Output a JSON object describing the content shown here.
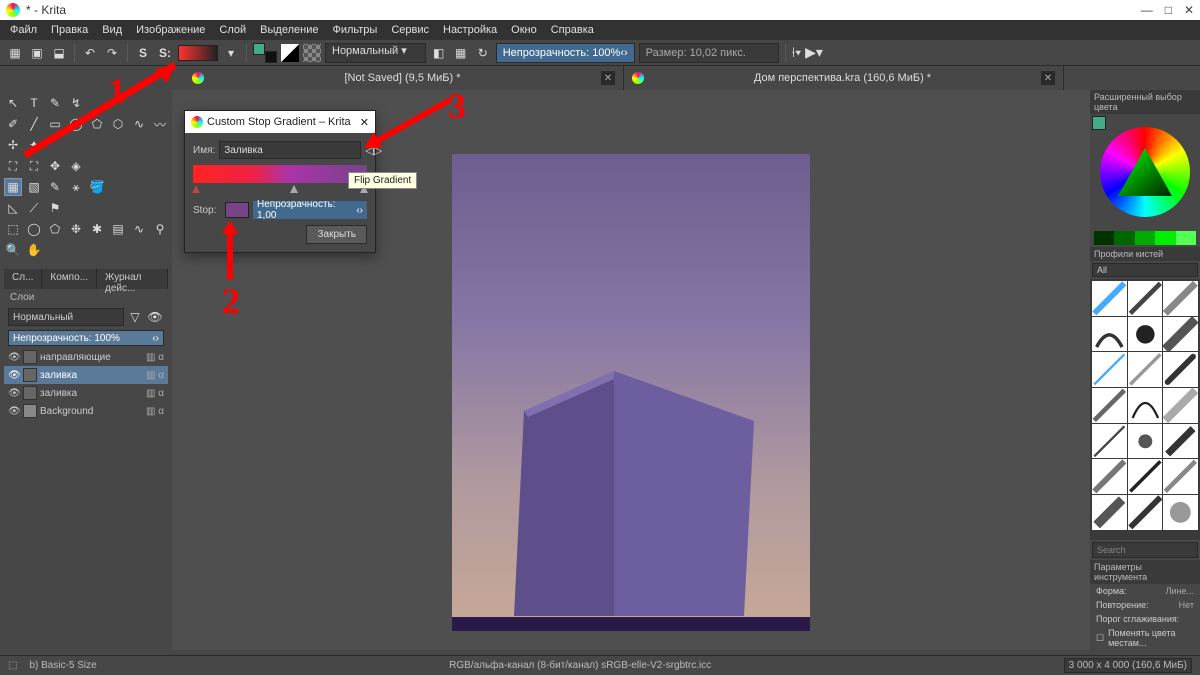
{
  "app_title": "* - Krita",
  "window_controls": {
    "min": "—",
    "max": "□",
    "close": "✕"
  },
  "menu": [
    "Файл",
    "Правка",
    "Вид",
    "Изображение",
    "Слой",
    "Выделение",
    "Фильтры",
    "Сервис",
    "Настройка",
    "Окно",
    "Справка"
  ],
  "toolbar": {
    "blend_mode": "Нормальный",
    "opacity_label": "Непрозрачность: 100%",
    "size_label": "Размер: 10,02 пикс."
  },
  "tabs": [
    {
      "title": "[Not Saved]  (9,5 МиБ) *"
    },
    {
      "title": "Дом перспектива.kra  (160,6 МиБ) *"
    }
  ],
  "left_panel": {
    "tabs": [
      "Сл...",
      "Компо...",
      "Журнал дейс..."
    ],
    "section": "Слои",
    "blend": "Нормальный",
    "opacity": "Непрозрачность:  100%",
    "layers": [
      {
        "name": "направляющие",
        "sel": false
      },
      {
        "name": "заливка",
        "sel": true
      },
      {
        "name": "заливка",
        "sel": false
      },
      {
        "name": "Background",
        "sel": false
      }
    ]
  },
  "dialog": {
    "title": "Custom Stop Gradient – Krita",
    "name_label": "Имя:",
    "name_value": "Заливка",
    "tooltip": "Flip Gradient",
    "stop_label": "Stop:",
    "stop_opacity": "Непрозрачность: 1,00",
    "close_btn": "Закрыть"
  },
  "right": {
    "color_title": "Расширенный выбор цвета",
    "brush_title": "Профили кистей",
    "brush_filter": "All",
    "search_ph": "Search",
    "toolopt_title": "Параметры инструмента",
    "shape_label": "Форма:",
    "shape_value": "Лине...",
    "repeat_label": "Повторение:",
    "repeat_value": "Нет",
    "thresh_label": "Порог сглаживания:",
    "swap_label": "Поменять цвета местам..."
  },
  "status": {
    "preset": "b)  Basic-5 Size",
    "color_info": "RGB/альфа-канал (8-бит/канал)  sRGB-elle-V2-srgbtrc.icc",
    "dims": "3 000 x 4 000 (160,6 МиБ)"
  },
  "annotations": {
    "a1": "1",
    "a2": "2",
    "a3": "3"
  },
  "colors": {
    "accent": "#416a8e",
    "red": "#f00"
  }
}
